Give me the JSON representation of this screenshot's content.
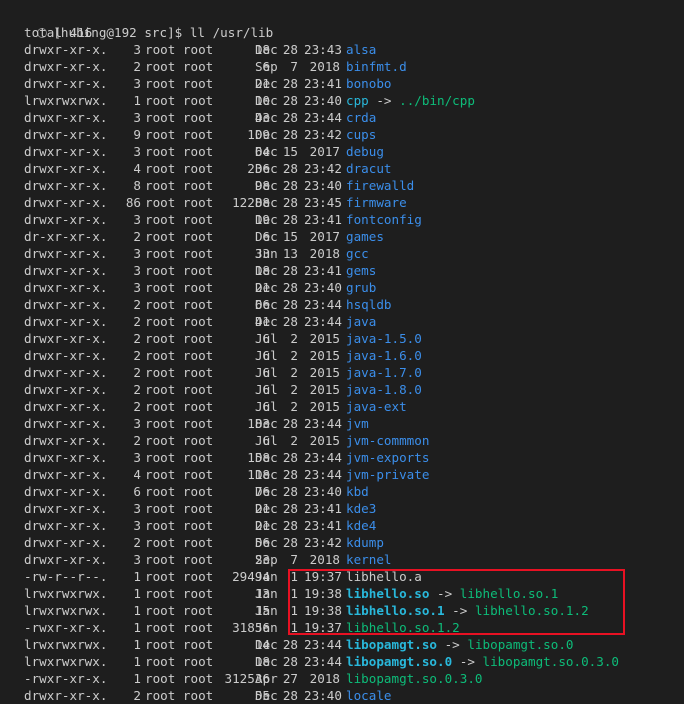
{
  "terminal": {
    "prompt": "[hubing@192 src]$ ll /usr/lib",
    "total": "total 416",
    "highlight_color": "#e81123",
    "rows": [
      {
        "perm": "drwxr-xr-x.",
        "links": "3",
        "owner": "root root",
        "size": "18",
        "month": "Dec",
        "day": "28",
        "time": "23:43",
        "name": "alsa",
        "type": "dir",
        "arrow": "",
        "target": "",
        "target_type": ""
      },
      {
        "perm": "drwxr-xr-x.",
        "links": "2",
        "owner": "root root",
        "size": "6",
        "month": "Sep",
        "day": "7",
        "time": "2018",
        "name": "binfmt.d",
        "type": "dir",
        "arrow": "",
        "target": "",
        "target_type": ""
      },
      {
        "perm": "drwxr-xr-x.",
        "links": "3",
        "owner": "root root",
        "size": "21",
        "month": "Dec",
        "day": "28",
        "time": "23:41",
        "name": "bonobo",
        "type": "dir",
        "arrow": "",
        "target": "",
        "target_type": ""
      },
      {
        "perm": "lrwxrwxrwx.",
        "links": "1",
        "owner": "root root",
        "size": "10",
        "month": "Dec",
        "day": "28",
        "time": "23:40",
        "name": "cpp",
        "type": "link",
        "arrow": "->",
        "target": "../bin/cpp",
        "target_type": "target-exe"
      },
      {
        "perm": "drwxr-xr-x.",
        "links": "3",
        "owner": "root root",
        "size": "43",
        "month": "Dec",
        "day": "28",
        "time": "23:44",
        "name": "crda",
        "type": "dir",
        "arrow": "",
        "target": "",
        "target_type": ""
      },
      {
        "perm": "drwxr-xr-x.",
        "links": "9",
        "owner": "root root",
        "size": "109",
        "month": "Dec",
        "day": "28",
        "time": "23:42",
        "name": "cups",
        "type": "dir",
        "arrow": "",
        "target": "",
        "target_type": ""
      },
      {
        "perm": "drwxr-xr-x.",
        "links": "3",
        "owner": "root root",
        "size": "64",
        "month": "Dec",
        "day": "15",
        "time": "2017",
        "name": "debug",
        "type": "dir",
        "arrow": "",
        "target": "",
        "target_type": ""
      },
      {
        "perm": "drwxr-xr-x.",
        "links": "4",
        "owner": "root root",
        "size": "236",
        "month": "Dec",
        "day": "28",
        "time": "23:42",
        "name": "dracut",
        "type": "dir",
        "arrow": "",
        "target": "",
        "target_type": ""
      },
      {
        "perm": "drwxr-xr-x.",
        "links": "8",
        "owner": "root root",
        "size": "98",
        "month": "Dec",
        "day": "28",
        "time": "23:40",
        "name": "firewalld",
        "type": "dir",
        "arrow": "",
        "target": "",
        "target_type": ""
      },
      {
        "perm": "drwxr-xr-x.",
        "links": "86",
        "owner": "root root",
        "size": "12288",
        "month": "Dec",
        "day": "28",
        "time": "23:45",
        "name": "firmware",
        "type": "dir",
        "arrow": "",
        "target": "",
        "target_type": ""
      },
      {
        "perm": "drwxr-xr-x.",
        "links": "3",
        "owner": "root root",
        "size": "19",
        "month": "Dec",
        "day": "28",
        "time": "23:41",
        "name": "fontconfig",
        "type": "dir",
        "arrow": "",
        "target": "",
        "target_type": ""
      },
      {
        "perm": "dr-xr-xr-x.",
        "links": "2",
        "owner": "root root",
        "size": "6",
        "month": "Dec",
        "day": "15",
        "time": "2017",
        "name": "games",
        "type": "dir",
        "arrow": "",
        "target": "",
        "target_type": ""
      },
      {
        "perm": "drwxr-xr-x.",
        "links": "3",
        "owner": "root root",
        "size": "33",
        "month": "Jun",
        "day": "13",
        "time": "2018",
        "name": "gcc",
        "type": "dir",
        "arrow": "",
        "target": "",
        "target_type": ""
      },
      {
        "perm": "drwxr-xr-x.",
        "links": "3",
        "owner": "root root",
        "size": "18",
        "month": "Dec",
        "day": "28",
        "time": "23:41",
        "name": "gems",
        "type": "dir",
        "arrow": "",
        "target": "",
        "target_type": ""
      },
      {
        "perm": "drwxr-xr-x.",
        "links": "3",
        "owner": "root root",
        "size": "21",
        "month": "Dec",
        "day": "28",
        "time": "23:40",
        "name": "grub",
        "type": "dir",
        "arrow": "",
        "target": "",
        "target_type": ""
      },
      {
        "perm": "drwxr-xr-x.",
        "links": "2",
        "owner": "root root",
        "size": "66",
        "month": "Dec",
        "day": "28",
        "time": "23:44",
        "name": "hsqldb",
        "type": "dir",
        "arrow": "",
        "target": "",
        "target_type": ""
      },
      {
        "perm": "drwxr-xr-x.",
        "links": "2",
        "owner": "root root",
        "size": "41",
        "month": "Dec",
        "day": "28",
        "time": "23:44",
        "name": "java",
        "type": "dir",
        "arrow": "",
        "target": "",
        "target_type": ""
      },
      {
        "perm": "drwxr-xr-x.",
        "links": "2",
        "owner": "root root",
        "size": "6",
        "month": "Jul",
        "day": "2",
        "time": "2015",
        "name": "java-1.5.0",
        "type": "dir",
        "arrow": "",
        "target": "",
        "target_type": ""
      },
      {
        "perm": "drwxr-xr-x.",
        "links": "2",
        "owner": "root root",
        "size": "6",
        "month": "Jul",
        "day": "2",
        "time": "2015",
        "name": "java-1.6.0",
        "type": "dir",
        "arrow": "",
        "target": "",
        "target_type": ""
      },
      {
        "perm": "drwxr-xr-x.",
        "links": "2",
        "owner": "root root",
        "size": "6",
        "month": "Jul",
        "day": "2",
        "time": "2015",
        "name": "java-1.7.0",
        "type": "dir",
        "arrow": "",
        "target": "",
        "target_type": ""
      },
      {
        "perm": "drwxr-xr-x.",
        "links": "2",
        "owner": "root root",
        "size": "6",
        "month": "Jul",
        "day": "2",
        "time": "2015",
        "name": "java-1.8.0",
        "type": "dir",
        "arrow": "",
        "target": "",
        "target_type": ""
      },
      {
        "perm": "drwxr-xr-x.",
        "links": "2",
        "owner": "root root",
        "size": "6",
        "month": "Jul",
        "day": "2",
        "time": "2015",
        "name": "java-ext",
        "type": "dir",
        "arrow": "",
        "target": "",
        "target_type": ""
      },
      {
        "perm": "drwxr-xr-x.",
        "links": "3",
        "owner": "root root",
        "size": "183",
        "month": "Dec",
        "day": "28",
        "time": "23:44",
        "name": "jvm",
        "type": "dir",
        "arrow": "",
        "target": "",
        "target_type": ""
      },
      {
        "perm": "drwxr-xr-x.",
        "links": "2",
        "owner": "root root",
        "size": "6",
        "month": "Jul",
        "day": "2",
        "time": "2015",
        "name": "jvm-commmon",
        "type": "dir",
        "arrow": "",
        "target": "",
        "target_type": ""
      },
      {
        "perm": "drwxr-xr-x.",
        "links": "3",
        "owner": "root root",
        "size": "158",
        "month": "Dec",
        "day": "28",
        "time": "23:44",
        "name": "jvm-exports",
        "type": "dir",
        "arrow": "",
        "target": "",
        "target_type": ""
      },
      {
        "perm": "drwxr-xr-x.",
        "links": "4",
        "owner": "root root",
        "size": "118",
        "month": "Dec",
        "day": "28",
        "time": "23:44",
        "name": "jvm-private",
        "type": "dir",
        "arrow": "",
        "target": "",
        "target_type": ""
      },
      {
        "perm": "drwxr-xr-x.",
        "links": "6",
        "owner": "root root",
        "size": "76",
        "month": "Dec",
        "day": "28",
        "time": "23:40",
        "name": "kbd",
        "type": "dir",
        "arrow": "",
        "target": "",
        "target_type": ""
      },
      {
        "perm": "drwxr-xr-x.",
        "links": "3",
        "owner": "root root",
        "size": "21",
        "month": "Dec",
        "day": "28",
        "time": "23:41",
        "name": "kde3",
        "type": "dir",
        "arrow": "",
        "target": "",
        "target_type": ""
      },
      {
        "perm": "drwxr-xr-x.",
        "links": "3",
        "owner": "root root",
        "size": "21",
        "month": "Dec",
        "day": "28",
        "time": "23:41",
        "name": "kde4",
        "type": "dir",
        "arrow": "",
        "target": "",
        "target_type": ""
      },
      {
        "perm": "drwxr-xr-x.",
        "links": "2",
        "owner": "root root",
        "size": "56",
        "month": "Dec",
        "day": "28",
        "time": "23:42",
        "name": "kdump",
        "type": "dir",
        "arrow": "",
        "target": "",
        "target_type": ""
      },
      {
        "perm": "drwxr-xr-x.",
        "links": "3",
        "owner": "root root",
        "size": "23",
        "month": "Sep",
        "day": "7",
        "time": "2018",
        "name": "kernel",
        "type": "dir",
        "arrow": "",
        "target": "",
        "target_type": ""
      },
      {
        "perm": "-rw-r--r--.",
        "links": "1",
        "owner": "root root",
        "size": "29494",
        "month": "Jan",
        "day": "1",
        "time": "19:37",
        "name": "libhello.a",
        "type": "file",
        "arrow": "",
        "target": "",
        "target_type": ""
      },
      {
        "perm": "lrwxrwxrwx.",
        "links": "1",
        "owner": "root root",
        "size": "13",
        "month": "Jan",
        "day": "1",
        "time": "19:38",
        "name": "libhello.so",
        "type": "bold",
        "arrow": "->",
        "target": "libhello.so.1",
        "target_type": "target-exe"
      },
      {
        "perm": "lrwxrwxrwx.",
        "links": "1",
        "owner": "root root",
        "size": "15",
        "month": "Jan",
        "day": "1",
        "time": "19:38",
        "name": "libhello.so.1",
        "type": "bold",
        "arrow": "->",
        "target": "libhello.so.1.2",
        "target_type": "target-exe"
      },
      {
        "perm": "-rwxr-xr-x.",
        "links": "1",
        "owner": "root root",
        "size": "31856",
        "month": "Jan",
        "day": "1",
        "time": "19:37",
        "name": "libhello.so.1.2",
        "type": "target-exe",
        "arrow": "",
        "target": "",
        "target_type": ""
      },
      {
        "perm": "lrwxrwxrwx.",
        "links": "1",
        "owner": "root root",
        "size": "14",
        "month": "Dec",
        "day": "28",
        "time": "23:44",
        "name": "libopamgt.so",
        "type": "bold",
        "arrow": "->",
        "target": "libopamgt.so.0",
        "target_type": "target-exe"
      },
      {
        "perm": "lrwxrwxrwx.",
        "links": "1",
        "owner": "root root",
        "size": "18",
        "month": "Dec",
        "day": "28",
        "time": "23:44",
        "name": "libopamgt.so.0",
        "type": "bold",
        "arrow": "->",
        "target": "libopamgt.so.0.3.0",
        "target_type": "target-exe"
      },
      {
        "perm": "-rwxr-xr-x.",
        "links": "1",
        "owner": "root root",
        "size": "312536",
        "month": "Apr",
        "day": "27",
        "time": "2018",
        "name": "libopamgt.so.0.3.0",
        "type": "target-exe",
        "arrow": "",
        "target": "",
        "target_type": ""
      },
      {
        "perm": "drwxr-xr-x.",
        "links": "2",
        "owner": "root root",
        "size": "55",
        "month": "Dec",
        "day": "28",
        "time": "23:40",
        "name": "locale",
        "type": "dir",
        "arrow": "",
        "target": "",
        "target_type": ""
      }
    ]
  }
}
